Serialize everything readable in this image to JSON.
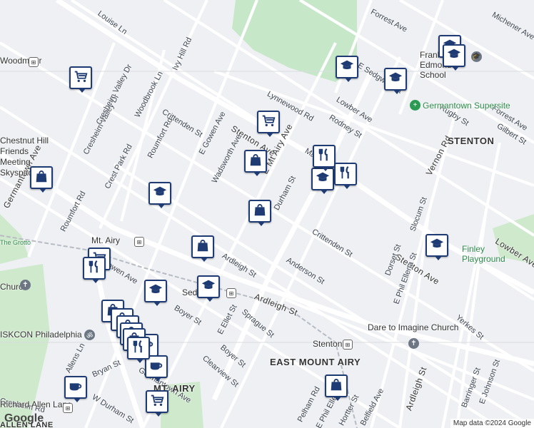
{
  "streets": [
    "Forrest Ave",
    "Michener Ave",
    "Louise Ln",
    "Ivy Hill Rd",
    "Lynnewood Rd",
    "E Sedgwick St",
    "Lowber Ave",
    "Rugby St",
    "Forrest Ave",
    "Cresheim Valley Dr",
    "Cresheim Valley Dr",
    "Woodbrook Ln",
    "Crittenden St",
    "Stenton Ave",
    "E Gowen Ave",
    "Rodney St",
    "Gilbert St",
    "Roumfort Rd",
    "Crest Park Rd",
    "Wadsworth Ave",
    "E Mt Airy Ave",
    "Mansfield Ave",
    "Durham St",
    "Vernon Rd",
    "Germantown Ave",
    "Roumfort Rd",
    "Crittenden St",
    "Lowber Ave",
    "Slocum St",
    "Ardleigh St",
    "Anderson St",
    "Stenton Ave",
    "Gowen Ave",
    "Dorset St",
    "E Phil Ellena St",
    "Ardleigh St",
    "Boyer St",
    "Sprague St",
    "E Ellet St",
    "Yerkes St",
    "Boyer St",
    "Clearview St",
    "Bryan St",
    "W Durham St",
    "Ardleigh St",
    "Barringer St",
    "E Johnson St",
    "Allens Ln",
    "Cresheim Rd",
    "Belfield Ave",
    "Hortter St",
    "E Phil Ellena St",
    "Pelham Rd",
    "Germantown Ave",
    "Mt Pleasant Ave"
  ],
  "places": {
    "mt_airy": "Mt. Airy",
    "the_grotto": "The Grotto",
    "stenton_station": "Stenton",
    "stenton_area": "STENTON",
    "east_mount_airy": "EAST MOUNT AIRY",
    "mt_airy_area": "MT. AIRY",
    "sedgwick": "Sedgwick",
    "franklin_edmonds": "Franklin Edmonds School",
    "germantown_supersite": "Germantown Supersite",
    "finley_playground": "Finley Playground",
    "dare_to_imagine": "Dare to Imagine Church",
    "iskcon": "ISKCON Philadelphia",
    "church": "Church",
    "friends_meeting": "Chestnut Hill Friends Meeting Skyspace",
    "woodmoor": "Woodmoor",
    "richard_allen_lane": "Richard Allen Lane",
    "allen_lane": "ALLEN LANE"
  },
  "markers": [
    {
      "type": "school",
      "label": "school-marker"
    },
    {
      "type": "school",
      "label": "school-marker"
    },
    {
      "type": "school",
      "label": "school-marker"
    },
    {
      "type": "school",
      "label": "school-marker"
    },
    {
      "type": "school",
      "label": "school-marker"
    },
    {
      "type": "school",
      "label": "school-marker"
    },
    {
      "type": "school",
      "label": "school-marker"
    },
    {
      "type": "school",
      "label": "school-marker"
    },
    {
      "type": "school",
      "label": "school-marker"
    },
    {
      "type": "cart",
      "label": "grocery-marker"
    },
    {
      "type": "cart",
      "label": "grocery-marker"
    },
    {
      "type": "cart",
      "label": "grocery-marker"
    },
    {
      "type": "cart",
      "label": "grocery-marker"
    },
    {
      "type": "bag",
      "label": "shopping-marker"
    },
    {
      "type": "bag",
      "label": "shopping-marker"
    },
    {
      "type": "bag",
      "label": "shopping-marker"
    },
    {
      "type": "bag",
      "label": "shopping-marker"
    },
    {
      "type": "bag",
      "label": "shopping-marker"
    },
    {
      "type": "food",
      "label": "restaurant-marker"
    },
    {
      "type": "food",
      "label": "restaurant-marker"
    },
    {
      "type": "food",
      "label": "restaurant-marker"
    },
    {
      "type": "cafe",
      "label": "cafe-marker"
    },
    {
      "type": "cafe",
      "label": "cafe-marker"
    },
    {
      "type": "cafe",
      "label": "cafe-marker"
    },
    {
      "type": "bag",
      "label": "shopping-marker"
    },
    {
      "type": "bag",
      "label": "shopping-marker"
    },
    {
      "type": "bag",
      "label": "shopping-marker"
    },
    {
      "type": "bag",
      "label": "shopping-marker"
    },
    {
      "type": "bag",
      "label": "shopping-marker"
    },
    {
      "type": "food",
      "label": "restaurant-marker"
    }
  ],
  "attribution": "Map data ©2024 Google",
  "logo": "Google"
}
